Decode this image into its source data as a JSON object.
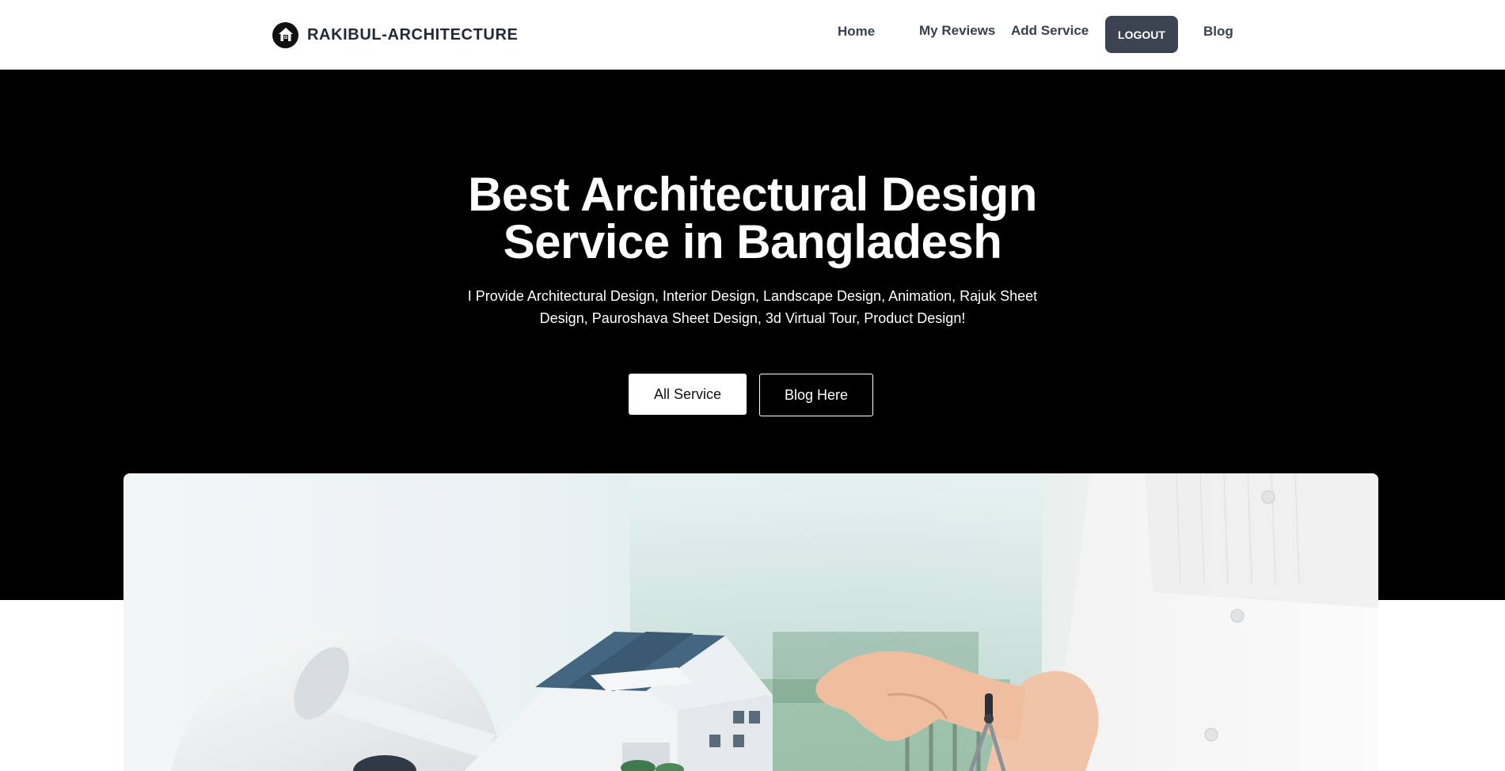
{
  "navbar": {
    "brand": "RAKIBUL-ARCHITECTURE",
    "links": {
      "home": "Home",
      "my_reviews": "My Reviews",
      "add_service": "Add Service",
      "logout": "LOGOUT",
      "blog": "Blog"
    },
    "logo_icon": "house-icon"
  },
  "hero": {
    "title_line1": "Best Architectural Design",
    "title_line2": "Service in Bangladesh",
    "description": "I Provide Architectural Design, Interior Design, Landscape Design, Animation, Rajuk Sheet Design, Pauroshava Sheet Design, 3d Virtual Tour, Product Design!",
    "primary_button": "All Service",
    "secondary_button": "Blog Here"
  },
  "colors": {
    "hero_background": "#000000",
    "logout_button": "#3d4451",
    "nav_text": "#374151"
  }
}
